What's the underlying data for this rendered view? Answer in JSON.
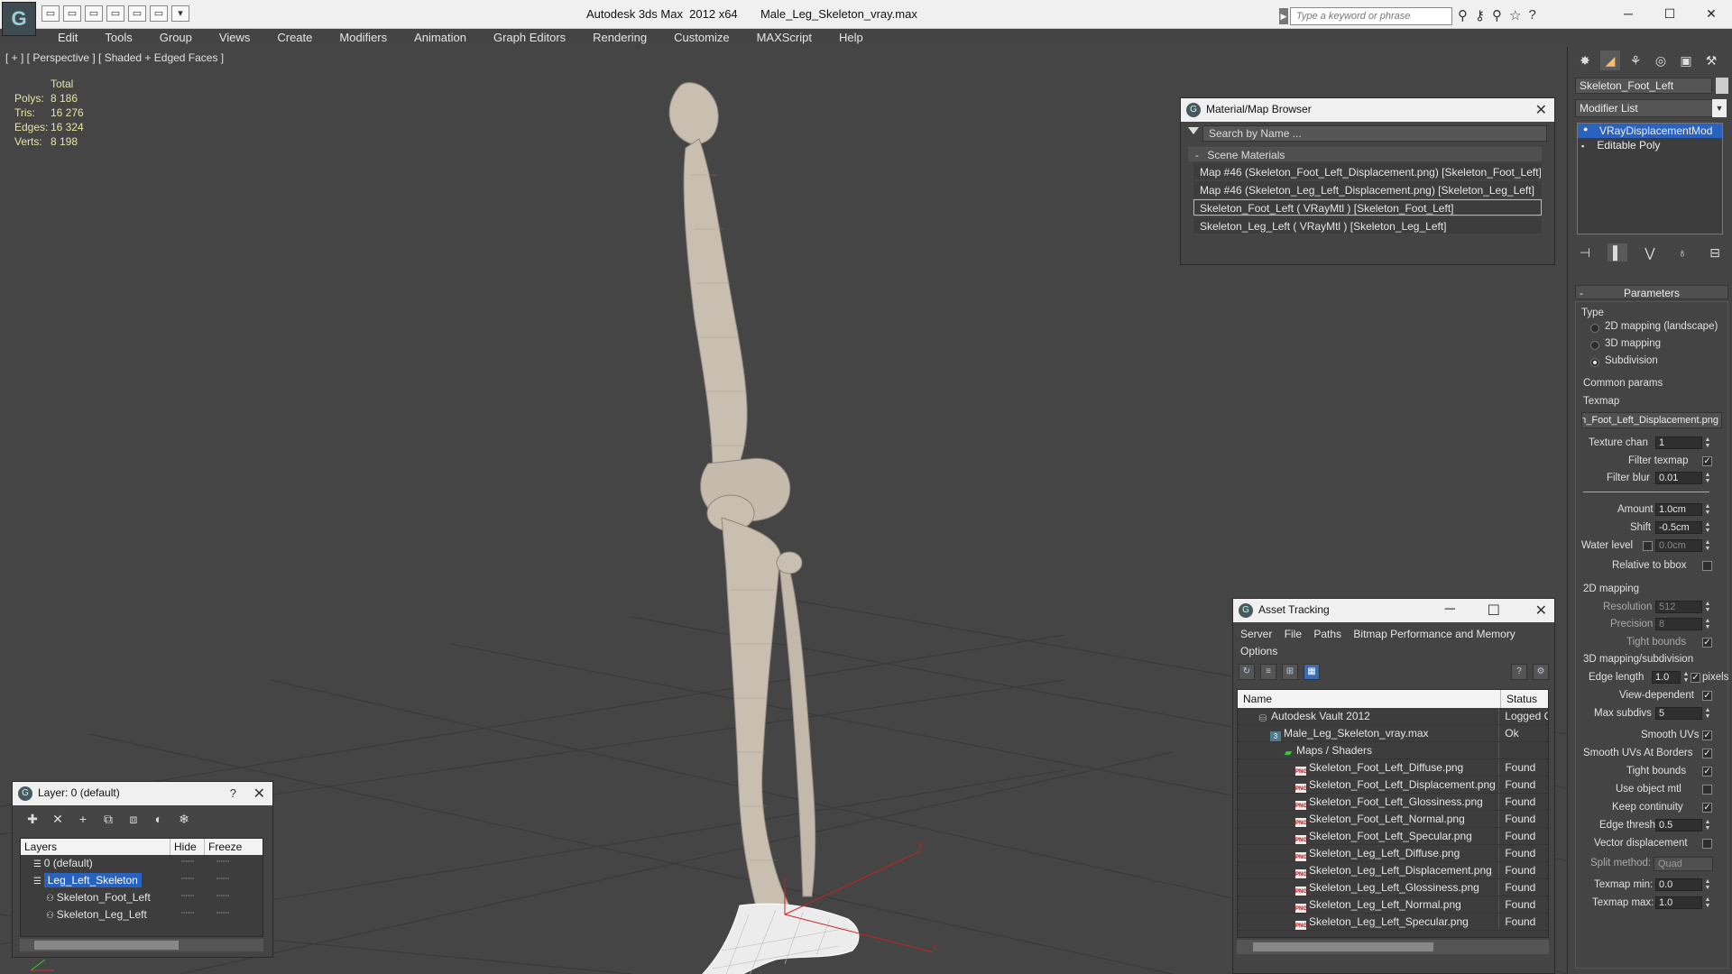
{
  "app": {
    "title": "Autodesk 3ds Max  2012 x64       Male_Leg_Skeleton_vray.max",
    "search_placeholder": "Type a keyword or phrase",
    "logo_glyph": "G"
  },
  "qat": [
    "▭",
    "▭",
    "▭",
    "▭",
    "▭",
    "▭",
    "▾"
  ],
  "search_icons": [
    "⚲",
    "⚷",
    "⚲",
    "☆",
    "?"
  ],
  "window_controls": {
    "minimize": "─",
    "maximize": "☐",
    "close": "✕"
  },
  "menubar": [
    "Edit",
    "Tools",
    "Group",
    "Views",
    "Create",
    "Modifiers",
    "Animation",
    "Graph Editors",
    "Rendering",
    "Customize",
    "MAXScript",
    "Help"
  ],
  "viewport": {
    "label": "[ + ] [ Perspective ] [ Shaded + Edged Faces ]",
    "stats": {
      "header": "Total",
      "rows": [
        {
          "label": "Polys:",
          "value": "8 186"
        },
        {
          "label": "Tris:",
          "value": "16 276"
        },
        {
          "label": "Edges:",
          "value": "16 324"
        },
        {
          "label": "Verts:",
          "value": "8 198"
        }
      ]
    },
    "axis_labels": {
      "x": "x",
      "y": "y",
      "z": "z"
    }
  },
  "material_browser": {
    "title": "Material/Map Browser",
    "search_placeholder": "Search by Name ...",
    "group": "Scene Materials",
    "group_toggle": "-",
    "items": [
      "Map #46 (Skeleton_Foot_Left_Displacement.png) [Skeleton_Foot_Left]",
      "Map #46 (Skeleton_Leg_Left_Displacement.png) [Skeleton_Leg_Left]",
      "Skeleton_Foot_Left  ( VRayMtl )  [Skeleton_Foot_Left]",
      "Skeleton_Leg_Left  ( VRayMtl )  [Skeleton_Leg_Left]"
    ],
    "selected_index": 2
  },
  "asset_tracking": {
    "title": "Asset Tracking",
    "menu_row1": [
      "Server",
      "File",
      "Paths",
      "Bitmap Performance and Memory"
    ],
    "menu_row2": [
      "Options"
    ],
    "columns": {
      "name": "Name",
      "status": "Status"
    },
    "rows": [
      {
        "indent": 1,
        "icon": "vault",
        "name": "Autodesk Vault 2012",
        "status": "Logged Out"
      },
      {
        "indent": 2,
        "icon": "max",
        "name": "Male_Leg_Skeleton_vray.max",
        "status": "Ok"
      },
      {
        "indent": 3,
        "icon": "maps",
        "name": "Maps / Shaders",
        "status": ""
      },
      {
        "indent": 4,
        "icon": "png",
        "name": "Skeleton_Foot_Left_Diffuse.png",
        "status": "Found"
      },
      {
        "indent": 4,
        "icon": "png",
        "name": "Skeleton_Foot_Left_Displacement.png",
        "status": "Found"
      },
      {
        "indent": 4,
        "icon": "png",
        "name": "Skeleton_Foot_Left_Glossiness.png",
        "status": "Found"
      },
      {
        "indent": 4,
        "icon": "png",
        "name": "Skeleton_Foot_Left_Normal.png",
        "status": "Found"
      },
      {
        "indent": 4,
        "icon": "png",
        "name": "Skeleton_Foot_Left_Specular.png",
        "status": "Found"
      },
      {
        "indent": 4,
        "icon": "png",
        "name": "Skeleton_Leg_Left_Diffuse.png",
        "status": "Found"
      },
      {
        "indent": 4,
        "icon": "png",
        "name": "Skeleton_Leg_Left_Displacement.png",
        "status": "Found"
      },
      {
        "indent": 4,
        "icon": "png",
        "name": "Skeleton_Leg_Left_Glossiness.png",
        "status": "Found"
      },
      {
        "indent": 4,
        "icon": "png",
        "name": "Skeleton_Leg_Left_Normal.png",
        "status": "Found"
      },
      {
        "indent": 4,
        "icon": "png",
        "name": "Skeleton_Leg_Left_Specular.png",
        "status": "Found"
      }
    ]
  },
  "layer_window": {
    "title": "Layer: 0 (default)",
    "help": "?",
    "columns": {
      "layers": "Layers",
      "hide": "Hide",
      "freeze": "Freeze"
    },
    "rows": [
      {
        "name": "0 (default)",
        "indent": 1,
        "selected": false
      },
      {
        "name": "Leg_Left_Skeleton",
        "indent": 1,
        "selected": true
      },
      {
        "name": "Skeleton_Foot_Left",
        "indent": 2,
        "selected": false
      },
      {
        "name": "Skeleton_Leg_Left",
        "indent": 2,
        "selected": false
      }
    ],
    "toggle_glyph": "┄┄"
  },
  "command_panel": {
    "object_name": "Skeleton_Foot_Left",
    "modifier_list": "Modifier List",
    "stack": [
      "VRayDisplacementMod",
      "Editable Poly"
    ],
    "params_title": "Parameters",
    "params_toggle": "-",
    "type_label": "Type",
    "type_options": [
      "2D mapping (landscape)",
      "3D mapping",
      "Subdivision"
    ],
    "type_selected": 2,
    "common_params": "Common params",
    "texmap_label": "Texmap",
    "texmap_value": "Skeleton_Foot_Left_Displacement.png)",
    "texture_chan_label": "Texture chan",
    "texture_chan_value": "1",
    "filter_texmap_label": "Filter texmap",
    "filter_blur_label": "Filter blur",
    "filter_blur_value": "0.01",
    "amount_label": "Amount",
    "amount_value": "1.0cm",
    "shift_label": "Shift",
    "shift_value": "-0.5cm",
    "water_level_label": "Water level",
    "water_level_value": "0.0cm",
    "relative_bbox_label": "Relative to bbox",
    "mapping2d_label": "2D mapping",
    "resolution_label": "Resolution",
    "resolution_value": "512",
    "precision_label": "Precision",
    "precision_value": "8",
    "tight_bounds_label": "Tight bounds",
    "mapping3d_label": "3D mapping/subdivision",
    "edge_length_label": "Edge length",
    "edge_length_value": "1.0",
    "pixels_label": "pixels",
    "view_dependent_label": "View-dependent",
    "max_subdivs_label": "Max subdivs",
    "max_subdivs_value": "5",
    "smooth_uvs_label": "Smooth UVs",
    "smooth_uvs_borders_label": "Smooth UVs At Borders",
    "tight_bounds2_label": "Tight bounds",
    "use_object_mtl_label": "Use object mtl",
    "keep_continuity_label": "Keep continuity",
    "edge_thresh_label": "Edge thresh",
    "edge_thresh_value": "0.5",
    "vector_disp_label": "Vector displacement",
    "split_method_label": "Split method:",
    "split_method_value": "Quad",
    "texmap_min_label": "Texmap min:",
    "texmap_min_value": "0.0",
    "texmap_max_label": "Texmap max:",
    "texmap_max_value": "1.0",
    "check_glyph": "✓"
  },
  "colors": {
    "viewport_bg": "#454545",
    "selection_blue": "#2a62c0",
    "bone": "#c8bfb0",
    "wire_foot": "#f2f2f2",
    "axis_red": "#cc2222"
  }
}
